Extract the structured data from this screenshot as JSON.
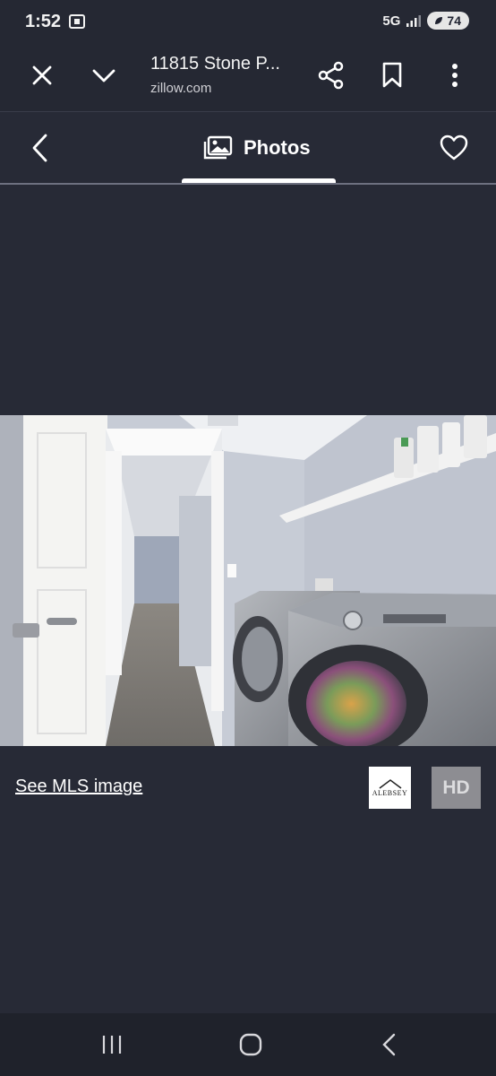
{
  "status_bar": {
    "time": "1:52",
    "network": "5G",
    "battery": "74"
  },
  "browser": {
    "page_title": "11815 Stone P...",
    "domain": "zillow.com"
  },
  "photo_header": {
    "label": "Photos"
  },
  "photo_footer": {
    "mls_link": "See MLS image",
    "agency_logo_text": "ALEBSEY",
    "hd_label": "HD"
  },
  "colors": {
    "background": "#272a36",
    "bar": "#252833",
    "nav": "#1f222b"
  },
  "icons": {
    "close": "close-icon",
    "chevron": "chevron-down-icon",
    "share": "share-icon",
    "bookmark": "bookmark-icon",
    "more": "more-vert-icon",
    "back": "chevron-left-icon",
    "photos": "photos-icon",
    "heart": "heart-icon"
  }
}
